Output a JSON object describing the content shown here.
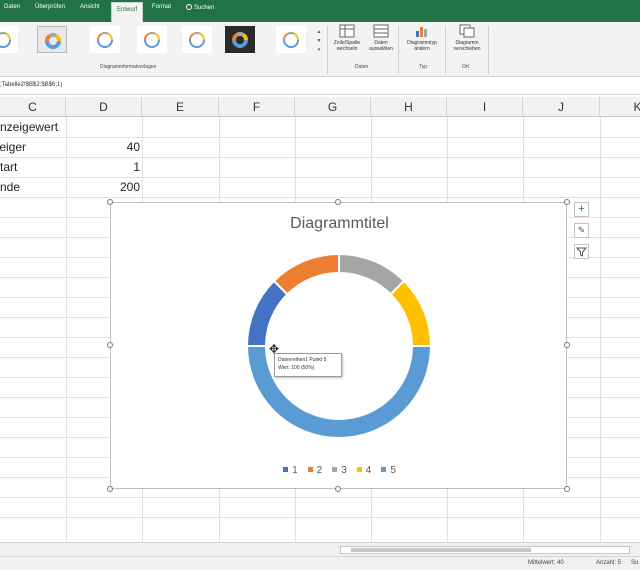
{
  "ribbon": {
    "tabs": [
      "Daten",
      "Überprüfen",
      "Ansicht",
      "Entwurf",
      "Format"
    ],
    "active_tab": "Entwurf",
    "search_label": "Suchen",
    "styles_group_label": "Diagrammformatvorlagen",
    "buttons": {
      "switch_row_col": "Zeile/Spalte wechseln",
      "select_data": "Daten auswählen",
      "change_type": "Diagrammtyp ändern",
      "move_chart": "Diagramm verschieben"
    },
    "group_labels": {
      "data": "Daten",
      "type": "Typ",
      "location": "Ort"
    }
  },
  "formula_bar": {
    "text": ";Tabelle2!$B$2:$B$6;1)"
  },
  "columns": [
    "C",
    "D",
    "E",
    "F",
    "G",
    "H",
    "I",
    "J",
    "K"
  ],
  "cells": {
    "c1": "Anzeigewert",
    "c2": "Zeiger",
    "d2": "40",
    "c3": "Start",
    "d3": "1",
    "c4": "Ende",
    "d4": "200"
  },
  "chart": {
    "title": "Diagrammtitel",
    "tooltip_line1": "Datenreihen1 Punkt 5",
    "tooltip_line2": "Wert: 100 (50%)"
  },
  "chart_data": {
    "type": "doughnut",
    "title": "Diagrammtitel",
    "categories": [
      "1",
      "2",
      "3",
      "4",
      "5"
    ],
    "values": [
      25,
      25,
      25,
      25,
      100
    ],
    "colors": [
      "#4472C4",
      "#ED7D31",
      "#A5A5A5",
      "#FFC000",
      "#5B9BD5"
    ],
    "segment_colors": [
      "#ED7D31",
      "#A5A5A5",
      "#FFC000",
      "#5B9BD5"
    ],
    "legend_position": "bottom"
  },
  "status": {
    "mittelwert": "Mittelwert: 40",
    "anzahl": "Anzahl: 5",
    "summe": "Su"
  },
  "colors": {
    "excel_green": "#217346"
  }
}
